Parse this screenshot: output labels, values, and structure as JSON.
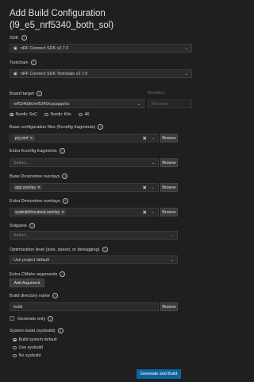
{
  "title": "Add Build Configuration (l9_e5_nrf5340_both_sol)",
  "sdk": {
    "label": "SDK",
    "value": "nRF Connect SDK v2.7.0"
  },
  "toolchain": {
    "label": "Toolchain",
    "value": "nRF Connect SDK Toolchain v2.7.0"
  },
  "board_target": {
    "label": "Board target",
    "value": "nrf5340dk/nrf5340/cpuapp/ns",
    "revision_label": "Revision",
    "revision_placeholder": "Revision",
    "filters": [
      "Nordic SoC",
      "Nordic Kits",
      "All"
    ],
    "selected_filter": "Nordic SoC"
  },
  "base_conf": {
    "label": "Base configuration files (Kconfig fragments)",
    "chip": "prj.conf",
    "browse": "Browse"
  },
  "extra_kconfig": {
    "label": "Extra Kconfig fragments",
    "placeholder": "Select...",
    "browse": "Browse"
  },
  "base_dt": {
    "label": "Base Devicetree overlays",
    "chip": "app.overlay",
    "browse": "Browse"
  },
  "extra_dt": {
    "label": "Extra Devicetree overlays",
    "chip": "sysbuild/mcuboot.overlay",
    "browse": "Browse"
  },
  "snippets": {
    "label": "Snippets",
    "placeholder": "Select..."
  },
  "optimization": {
    "label": "Optimization level (size, speed, or debugging)",
    "value": "Use project default"
  },
  "cmake": {
    "label": "Extra CMake arguments",
    "button": "Add Argument"
  },
  "build_dir": {
    "label": "Build directory name",
    "value": "build",
    "browse": "Browse"
  },
  "generate_only": {
    "label": "Generate only"
  },
  "sysbuild": {
    "label": "System build (sysbuild)",
    "options": [
      "Build system default",
      "Use sysbuild",
      "No sysbuild"
    ],
    "selected": "Build system default"
  },
  "primary_button": "Generate and Build",
  "icons": {
    "help": "info-circle-icon",
    "chevron": "chevron-down-icon",
    "chip": "chip-icon",
    "clear": "close-icon"
  }
}
